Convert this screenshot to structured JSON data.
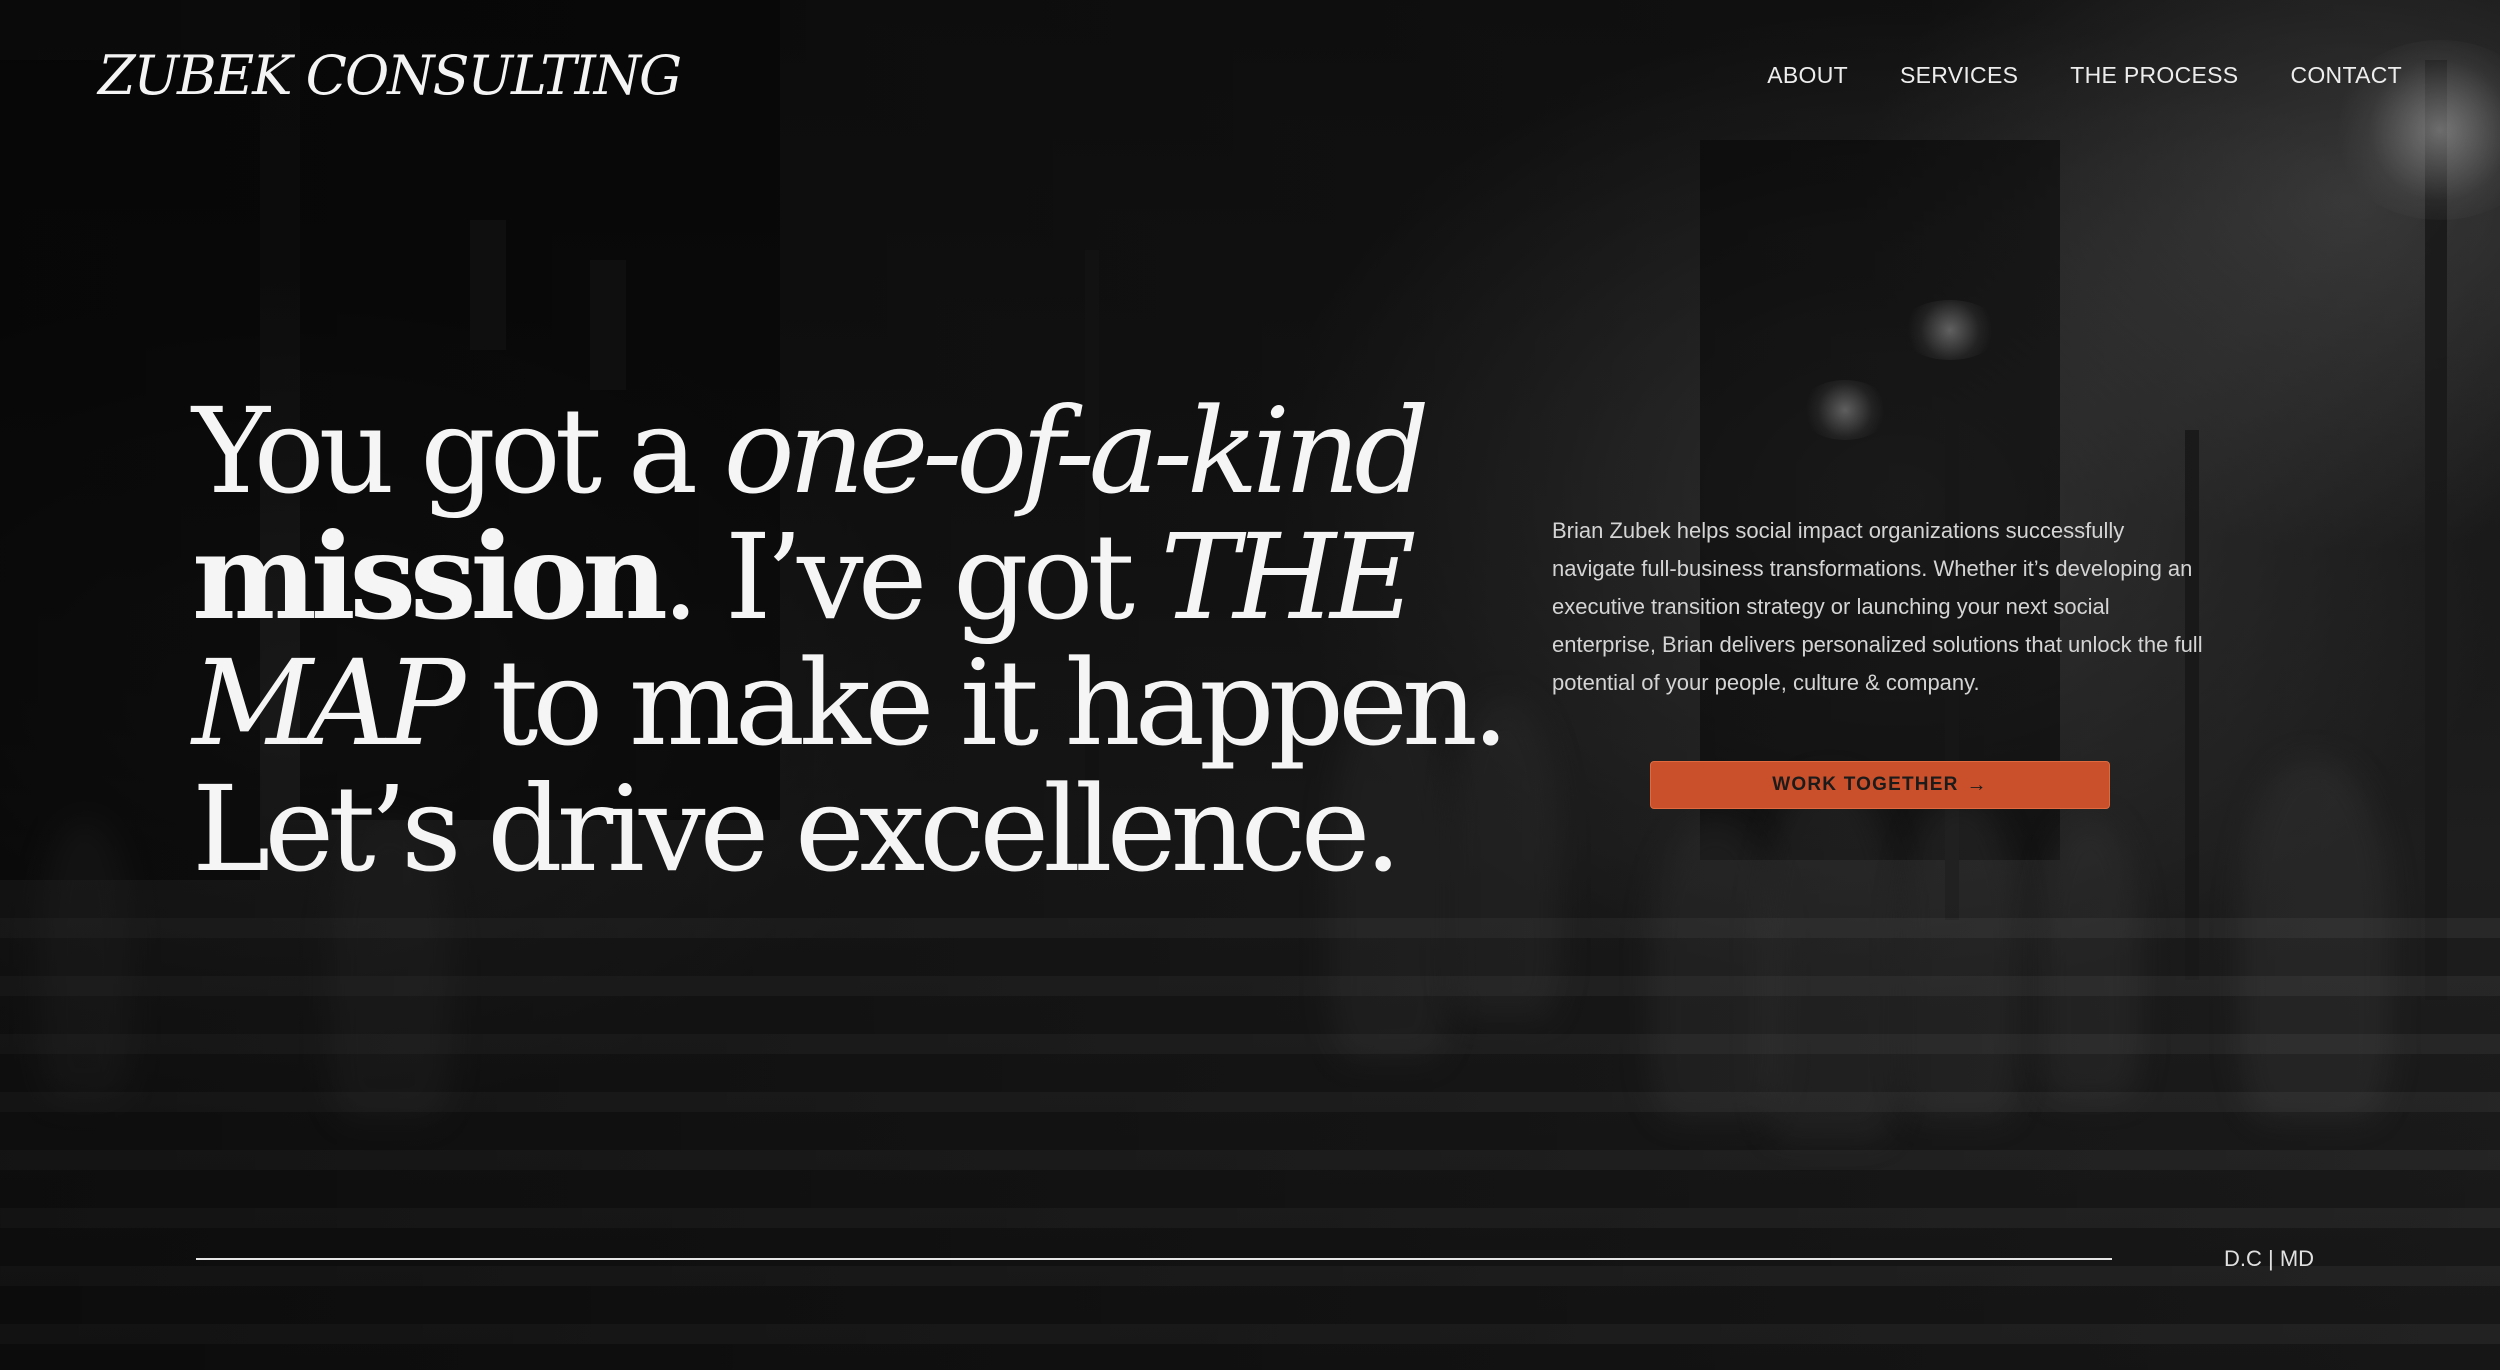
{
  "brand": {
    "logo_text": "ZUBEK CONSULTING"
  },
  "nav": {
    "items": [
      {
        "label": "ABOUT"
      },
      {
        "label": "SERVICES"
      },
      {
        "label": "THE PROCESS"
      },
      {
        "label": "CONTACT"
      }
    ]
  },
  "hero": {
    "headline": {
      "l1a": "You got a ",
      "l1b": "one-of-a-kind",
      "l2a": "mission",
      "l2b": ". I’ve got ",
      "l2c": "THE",
      "l3a": "MAP",
      "l3b": " to make it happen.",
      "l4": "Let’s drive excellence."
    },
    "blurb": "Brian Zubek helps social impact organizations successfully navigate full-business transformations. Whether it’s developing an executive transition strategy or launching your next social enterprise, Brian delivers personalized solutions that unlock the full potential of your people, culture & company.",
    "cta_label": "WORK TOGETHER",
    "cta_arrow": "→"
  },
  "footer": {
    "location": "D.C | MD"
  },
  "colors": {
    "accent": "#c9502a",
    "text": "#f5f5f5",
    "background": "#111111"
  },
  "icons": {
    "cta_icon": "arrow-right-icon"
  }
}
